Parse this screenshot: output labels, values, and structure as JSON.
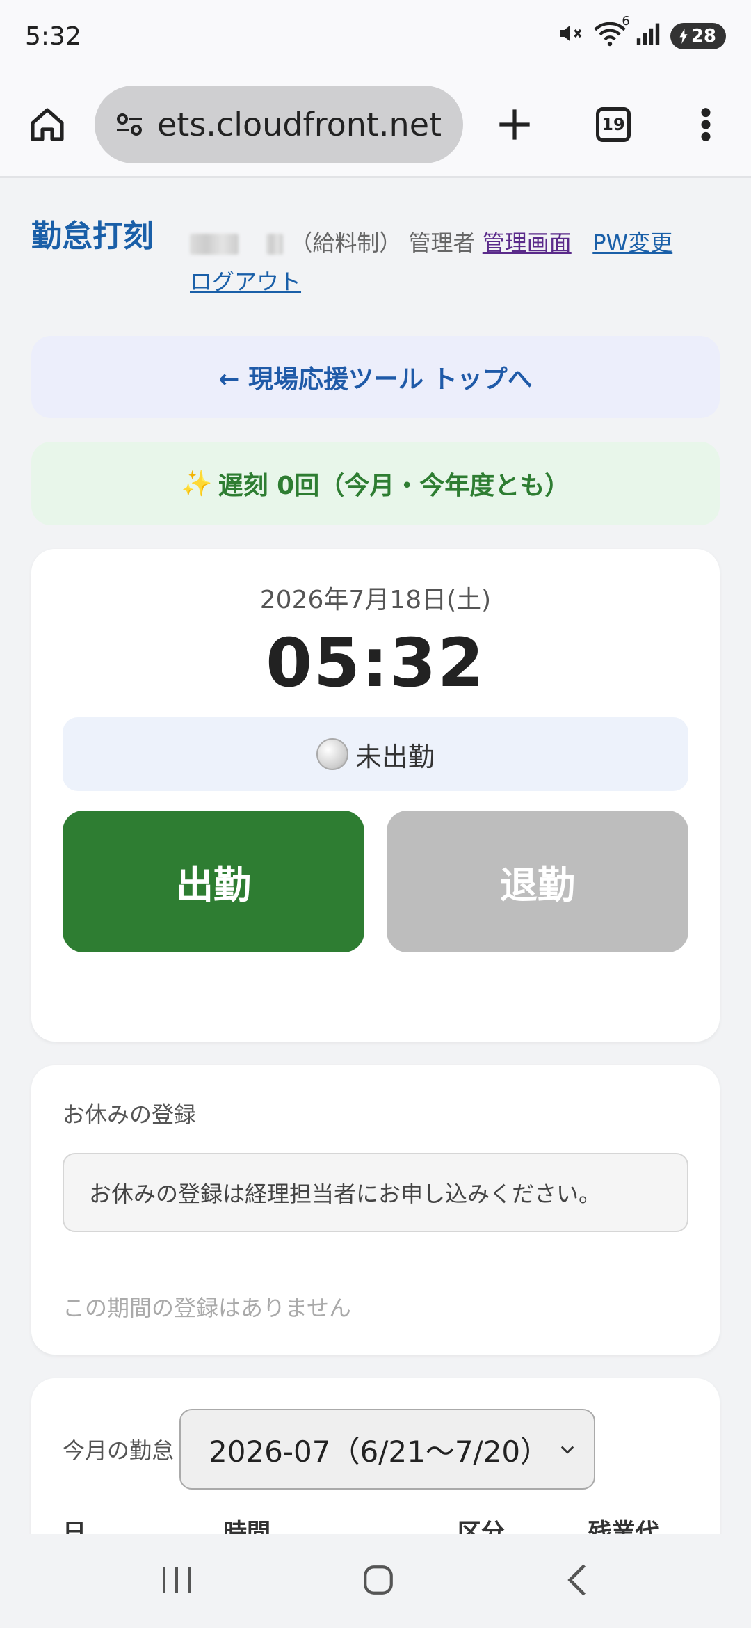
{
  "status_bar": {
    "time": "5:32",
    "battery": "28",
    "icons": [
      "mute-icon",
      "wifi-icon",
      "signal-icon",
      "battery-icon"
    ],
    "wifi_badge": "6"
  },
  "browser": {
    "url": "ets.cloudfront.net",
    "tab_count": "19"
  },
  "header": {
    "title": "勤怠打刻",
    "pay_type": "（給料制）",
    "role": "管理者",
    "admin_link": "管理画面",
    "pw_link": "PW変更",
    "logout_link": "ログアウト"
  },
  "banners": {
    "back_top": "← 現場応援ツール トップへ",
    "late_emoji": "✨",
    "late_text": "遅刻 0回（今月・今年度とも）"
  },
  "clock": {
    "date": "2026年7月18日(土)",
    "time": "05:32",
    "status_text": "未出勤",
    "clock_in_label": "出勤",
    "clock_out_label": "退勤"
  },
  "leave": {
    "section_label": "お休みの登録",
    "notice": "お休みの登録は経理担当者にお申し込みください。",
    "empty_text": "この期間の登録はありません"
  },
  "attendance": {
    "label": "今月の勤怠",
    "selected_month": "2026-07（6/21〜7/20）",
    "columns": [
      "日",
      "時間",
      "区分",
      "残業代"
    ]
  },
  "colors": {
    "primary_blue": "#1a5fa8",
    "clock_in_green": "#2e7d32",
    "clock_out_gray": "#bdbdbd",
    "green_banner_bg": "#e8f6ea",
    "blue_banner_bg": "#eceefb"
  }
}
